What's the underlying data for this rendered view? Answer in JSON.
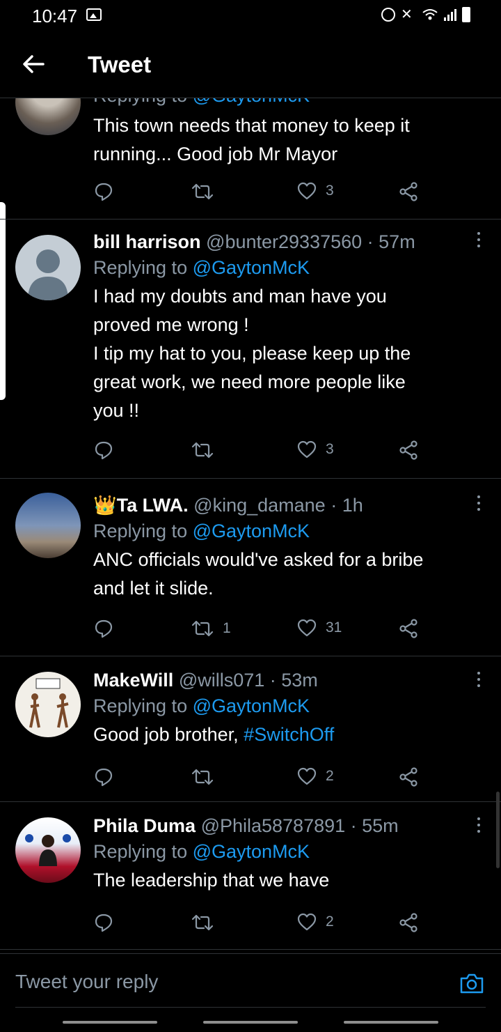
{
  "status_bar": {
    "time": "10:47"
  },
  "app_bar": {
    "title": "Tweet"
  },
  "tweets": [
    {
      "reply_prefix": "Replying to",
      "mention": "@GaytonMcK",
      "text": "This town needs that money to keep it running... Good job Mr Mayor",
      "retweets": "",
      "likes": "3"
    },
    {
      "name": "bill harrison",
      "handle": "@bunter29337560",
      "time": "· 57m",
      "reply_prefix": "Replying to",
      "mention": "@GaytonMcK",
      "text_lines": [
        "I had my doubts and man have you",
        "proved me wrong !",
        "I tip my hat to you, please keep up the",
        "great work, we need more people like",
        "you !!"
      ],
      "retweets": "",
      "likes": "3"
    },
    {
      "name_emoji": "👑",
      "name": "Ta LWA.",
      "handle": "@king_damane",
      "time": "· 1h",
      "reply_prefix": "Replying to",
      "mention": "@GaytonMcK",
      "text_lines": [
        "ANC officials would've asked for a bribe",
        "and let it slide."
      ],
      "retweets": "1",
      "likes": "31"
    },
    {
      "name": "MakeWill",
      "handle": "@wills071",
      "time": "· 53m",
      "reply_prefix": "Replying to",
      "mention": "@GaytonMcK",
      "text_plain": "Good job brother,",
      "hashtag": "#SwitchOff",
      "retweets": "",
      "likes": "2"
    },
    {
      "name": "Phila Duma",
      "handle": "@Phila58787891",
      "time": "· 55m",
      "reply_prefix": "Replying to",
      "mention": "@GaytonMcK",
      "text": "The leadership that we have",
      "retweets": "",
      "likes": "2"
    }
  ],
  "composer": {
    "placeholder": "Tweet your reply"
  },
  "colors": {
    "accent": "#1d9bf0",
    "secondary_text": "#8b98a5",
    "background": "#000000",
    "divider": "#2f3336"
  },
  "icons": [
    "back-arrow-icon",
    "reply-icon",
    "retweet-icon",
    "like-icon",
    "share-icon",
    "more-icon",
    "camera-icon"
  ]
}
